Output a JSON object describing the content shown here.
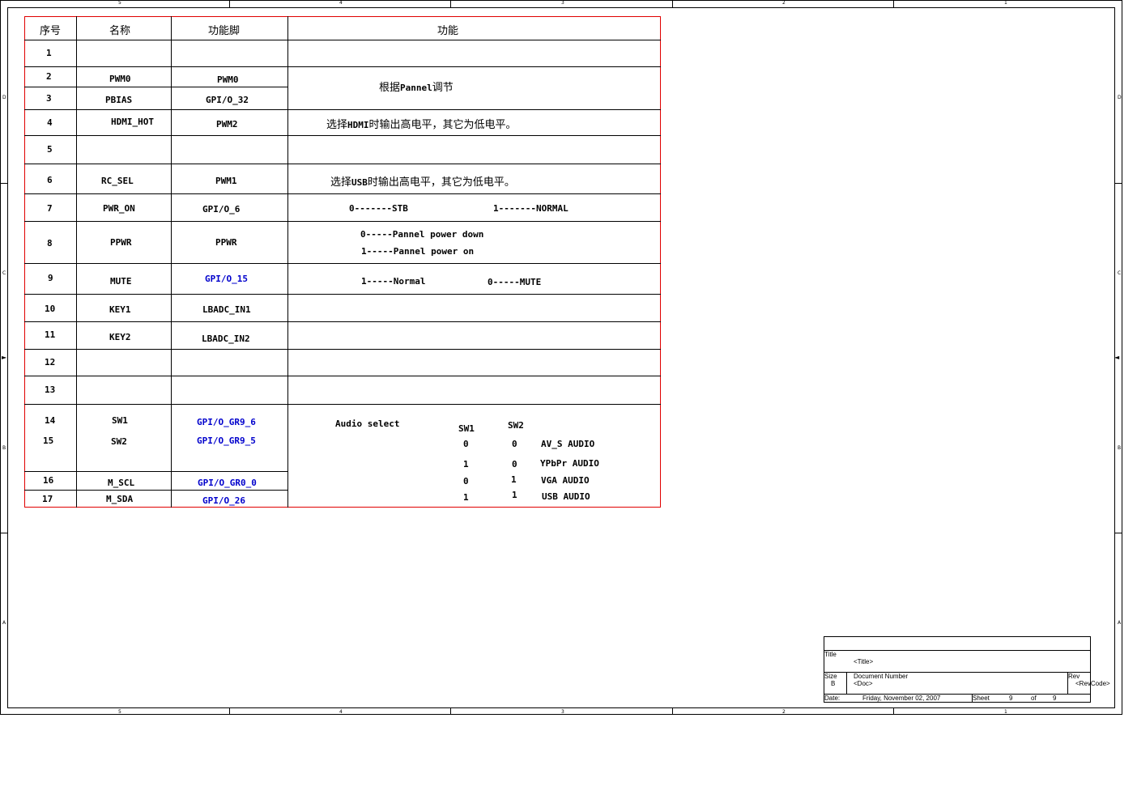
{
  "border": {
    "top_zones": [
      "5",
      "4",
      "3",
      "2",
      "1"
    ],
    "bottom_zones": [
      "5",
      "4",
      "3",
      "2",
      "1"
    ],
    "left_zones": [
      "D",
      "C",
      "B",
      "A"
    ],
    "right_zones": [
      "D",
      "C",
      "B",
      "A"
    ]
  },
  "table": {
    "headers": [
      "序号",
      "名称",
      "功能脚",
      "功能"
    ],
    "rows": [
      {
        "no": "1",
        "name": "",
        "pin": ""
      },
      {
        "no": "2",
        "name": "PWM0",
        "pin": "PWM0"
      },
      {
        "no": "3",
        "name": "PBIAS",
        "pin": "GPI/O_32"
      },
      {
        "no": "4",
        "name": "HDMI_HOT",
        "pin": "PWM2"
      },
      {
        "no": "5",
        "name": "",
        "pin": ""
      },
      {
        "no": "6",
        "name": "RC_SEL",
        "pin": "PWM1"
      },
      {
        "no": "7",
        "name": "PWR_ON",
        "pin": "GPI/O_6"
      },
      {
        "no": "8",
        "name": "PPWR",
        "pin": "PPWR"
      },
      {
        "no": "9",
        "name": "MUTE",
        "pin": "GPI/O_15"
      },
      {
        "no": "10",
        "name": "KEY1",
        "pin": "LBADC_IN1"
      },
      {
        "no": "11",
        "name": "KEY2",
        "pin": "LBADC_IN2"
      },
      {
        "no": "12",
        "name": "",
        "pin": ""
      },
      {
        "no": "13",
        "name": "",
        "pin": ""
      },
      {
        "no": "14",
        "name": "SW1",
        "pin": "GPI/O_GR9_6"
      },
      {
        "no": "15",
        "name": "SW2",
        "pin": "GPI/O_GR9_5"
      },
      {
        "no": "16",
        "name": "M_SCL",
        "pin": "GPI/O_GR0_0"
      },
      {
        "no": "17",
        "name": "M_SDA",
        "pin": "GPI/O_26"
      }
    ],
    "functions": {
      "pannel_pre": "根据",
      "pannel_mid": "Pannel",
      "pannel_post": "调节",
      "hdmi_pre": "选择",
      "hdmi_mid": "HDMI",
      "hdmi_post": "时输出高电平，其它为低电平。",
      "usb_pre": "选择",
      "usb_mid": "USB",
      "usb_post": "时输出高电平，其它为低电平。",
      "pwr_stb": "0-------STB",
      "pwr_normal": "1-------NORMAL",
      "ppwr_down": "0-----Pannel power down",
      "ppwr_on": "1-----Pannel power on",
      "mute_normal": "1-----Normal",
      "mute_mute": "0-----MUTE",
      "audio_select": "Audio select",
      "audio_head_sw1": "SW1",
      "audio_head_sw2": "SW2",
      "audio_rows": [
        {
          "sw1": "0",
          "sw2": "0",
          "label": "AV_S AUDIO"
        },
        {
          "sw1": "1",
          "sw2": "0",
          "label": "YPbPr AUDIO"
        },
        {
          "sw1": "0",
          "sw2": "1",
          "label": "VGA AUDIO"
        },
        {
          "sw1": "1",
          "sw2": "1",
          "label": "USB AUDIO"
        }
      ]
    }
  },
  "title_block": {
    "title_label": "Title",
    "title_value": "<Title>",
    "size_label": "Size",
    "size_value": "B",
    "docnum_label": "Document Number",
    "docnum_value": "<Doc>",
    "rev_label": "Rev",
    "rev_value": "<RevCode>",
    "date_label": "Date:",
    "date_value": "Friday, November 02, 2007",
    "sheet_label": "Sheet",
    "sheet_value": "9",
    "of_label": "of",
    "of_value": "9"
  }
}
